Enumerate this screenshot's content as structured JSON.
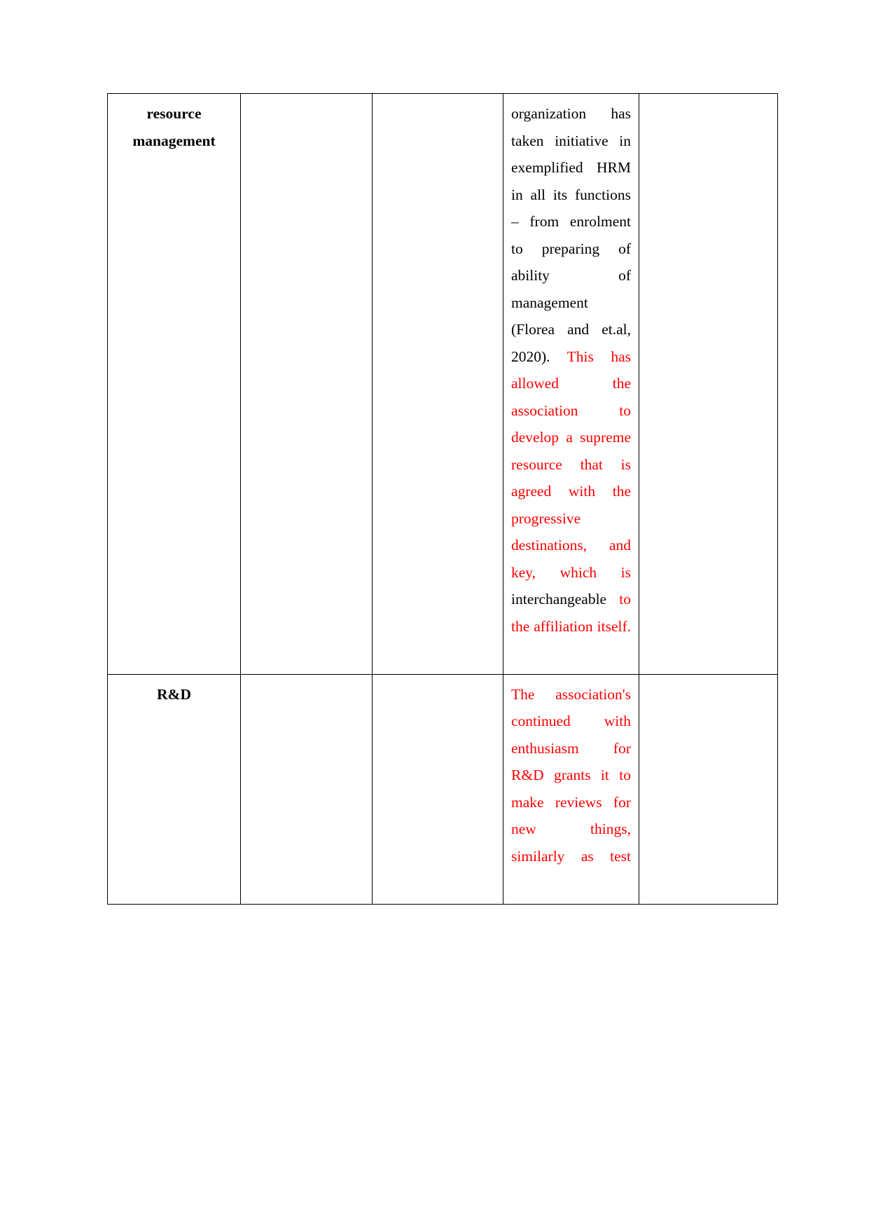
{
  "document": {
    "page_background": "#ffffff",
    "text_color": "#000000",
    "highlight_color": "#ff0000",
    "border_color": "#000000"
  },
  "table": {
    "column_count": 5,
    "rows": [
      {
        "id": "row-resource-management",
        "label": "resource management",
        "col2": "",
        "col3": "",
        "col5": "",
        "content_segments": [
          {
            "color": "#000000",
            "text": "organization has taken initiative in exemplified HRM in all its functions – from enrolment to preparing of ability of management (Florea and et.al, 2020). "
          },
          {
            "color": "#ff0000",
            "text": "This has allowed the association to develop a supreme resource that is agreed with the progressive destinations, and key, which is "
          },
          {
            "color": "#000000",
            "text": "interchangeable "
          },
          {
            "color": "#ff0000",
            "text": "to the affiliation itself."
          }
        ]
      },
      {
        "id": "row-rd",
        "label": "R&D",
        "col2": "",
        "col3": "",
        "col5": "",
        "content_segments": [
          {
            "color": "#ff0000",
            "text": "The association's continued with enthusiasm for R&D grants it to make reviews for new things, similarly as test"
          }
        ]
      }
    ]
  }
}
